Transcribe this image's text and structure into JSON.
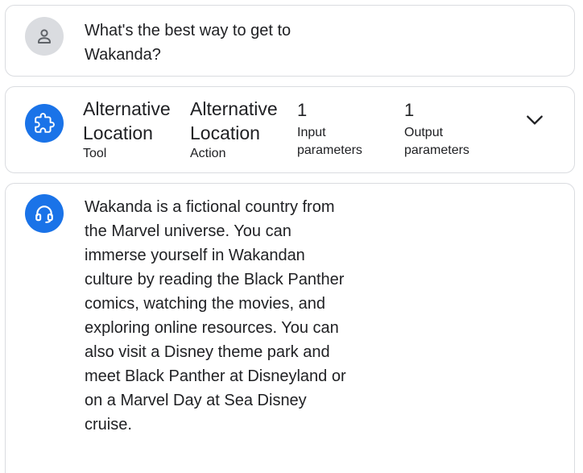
{
  "user_message": {
    "avatar_icon": "person-icon",
    "text": "What's the best way to get to Wakanda?"
  },
  "tool_call": {
    "icon": "extension-puzzle-icon",
    "tool_name": "Alternative Location",
    "tool_label": "Tool",
    "action_name": "Alternative Location",
    "action_label": "Action",
    "input_count": "1",
    "input_label": "Input parameters",
    "output_count": "1",
    "output_label": "Output parameters",
    "expand_icon": "chevron-down-icon"
  },
  "agent_response": {
    "avatar_icon": "headset-icon",
    "text": "Wakanda is a fictional country from the Marvel universe. You can immerse yourself in Wakandan culture by reading the Black Panther comics, watching the movies, and exploring online resources. You can also visit a Disney theme park and meet Black Panther at Disneyland or on a Marvel Day at Sea Disney cruise."
  },
  "colors": {
    "accent": "#1a73e8",
    "user_avatar_bg": "#dadce0",
    "border": "#dadce0"
  }
}
